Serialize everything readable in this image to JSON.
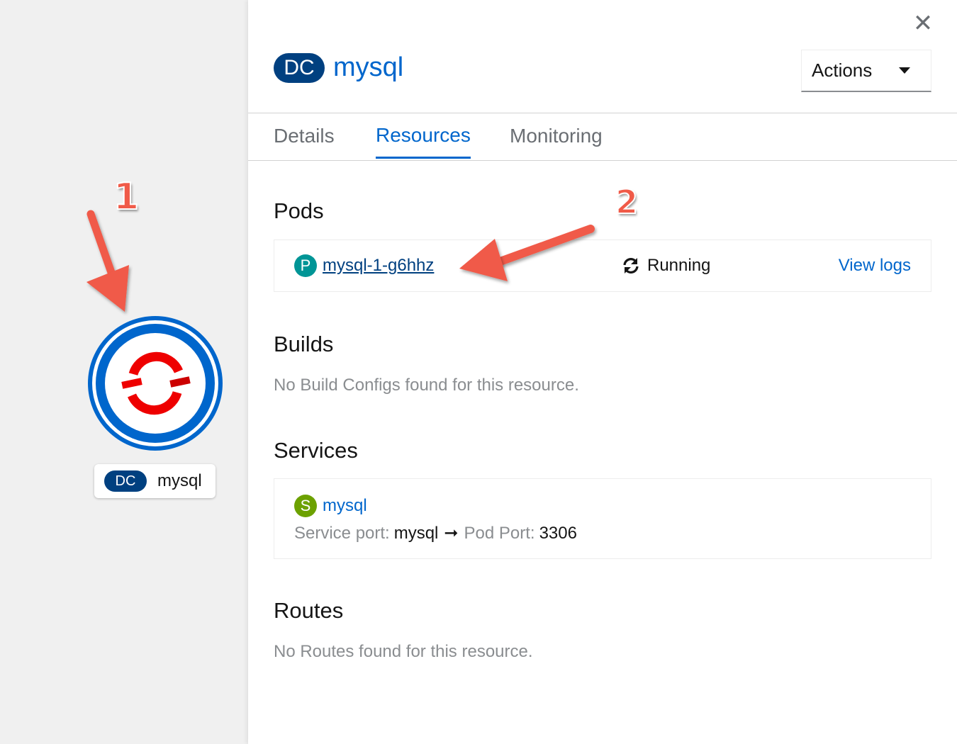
{
  "topology_node": {
    "kind_badge": "DC",
    "name": "mysql",
    "colors": {
      "ring": "#0066cc",
      "logo": "#e00"
    }
  },
  "panel": {
    "close_icon": "close-icon",
    "header": {
      "kind_badge": "DC",
      "title": "mysql"
    },
    "actions": {
      "label": "Actions"
    },
    "tabs": [
      {
        "label": "Details",
        "active": false
      },
      {
        "label": "Resources",
        "active": true
      },
      {
        "label": "Monitoring",
        "active": false
      }
    ],
    "pods": {
      "heading": "Pods",
      "items": [
        {
          "badge": "P",
          "name": "mysql-1-g6hhz",
          "status": "Running",
          "action": "View logs"
        }
      ]
    },
    "builds": {
      "heading": "Builds",
      "empty_message": "No Build Configs found for this resource."
    },
    "services": {
      "heading": "Services",
      "items": [
        {
          "badge": "S",
          "name": "mysql",
          "service_port_label": "Service port:",
          "service_port_value": "mysql",
          "arrow": "➞",
          "pod_port_label": "Pod Port:",
          "pod_port_value": "3306"
        }
      ]
    },
    "routes": {
      "heading": "Routes",
      "empty_message": "No Routes found for this resource."
    }
  },
  "annotations": {
    "step1": "1",
    "step2": "2",
    "color": "#f05a48"
  },
  "colors": {
    "link": "#0066cc",
    "dc_badge": "#004080",
    "pod_badge": "#009596",
    "service_badge": "#6ca100"
  }
}
